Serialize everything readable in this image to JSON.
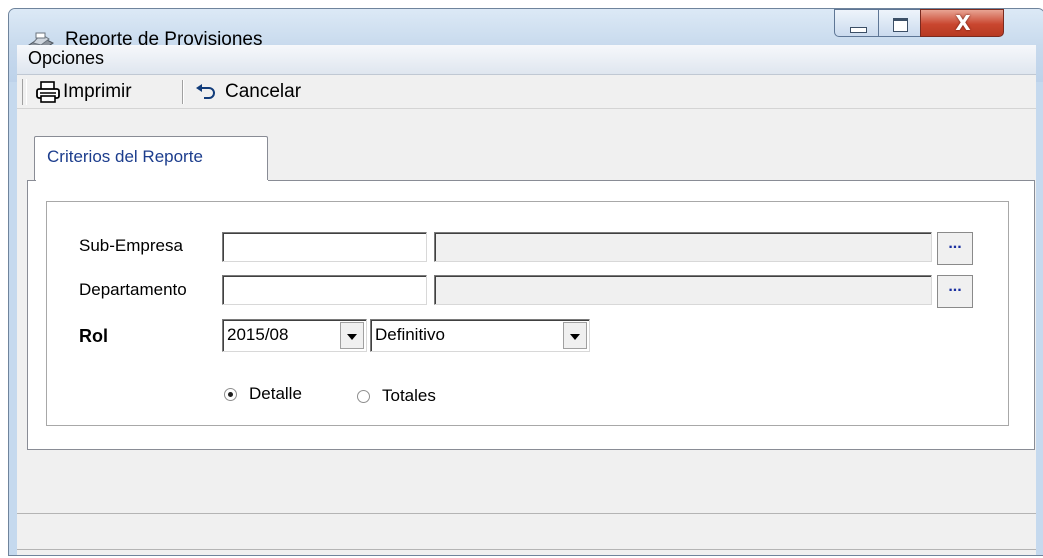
{
  "window": {
    "title": "Reporte de Provisiones",
    "controls": {
      "minimize": "minimize",
      "maximize": "maximize",
      "close": "X"
    }
  },
  "menu": {
    "items": [
      "Opciones"
    ]
  },
  "toolbar": {
    "print_label": "Imprimir",
    "print_icon": "printer-icon",
    "cancel_label": "Cancelar",
    "cancel_icon": "undo-arrow-icon"
  },
  "tabs": {
    "active_label": "Criterios del Reporte"
  },
  "form": {
    "sub_empresa": {
      "label": "Sub-Empresa",
      "code": "",
      "description": "",
      "lookup": "..."
    },
    "departamento": {
      "label": "Departamento",
      "code": "",
      "description": "",
      "lookup": "..."
    },
    "rol": {
      "label": "Rol",
      "period": "2015/08",
      "type": "Definitivo"
    },
    "view": {
      "detalle": "Detalle",
      "totales": "Totales",
      "selected": "Detalle"
    }
  },
  "colors": {
    "tab_text": "#1c3d8d",
    "lookup_dots": "#1a2fa0",
    "close_button": "#c9462f"
  }
}
